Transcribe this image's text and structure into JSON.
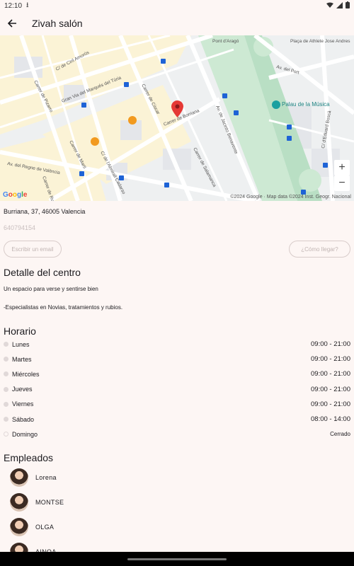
{
  "status_bar": {
    "time": "12:10"
  },
  "header": {
    "title": "Zivah salón"
  },
  "map": {
    "street_labels": [
      "Gran Via del Marqués del Túria",
      "Carrer de Borriana",
      "Av. de Jacinto Benavente",
      "C/ de l'Almirall Cadarso",
      "Carrer de Ciscar",
      "Carrer de Salamanca",
      "Av. del Regne de València",
      "Carrer de Russafa",
      "C/ de Ciril Amorós",
      "Carrer de Pizarro",
      "Carrer de Marti",
      "Av. del Port",
      "Palau de la Música",
      "Pont d'Aragó",
      "Plaça de Athlete Jose Andres",
      "C/ d'Eduard Boscà"
    ],
    "google_logo": "Google",
    "copyright": "©2024 Google · Map data ©2024 Inst. Geogr. Nacional"
  },
  "contact": {
    "address": "Burriana, 37, 46005 Valencia",
    "phone": "640794154",
    "email_button": "Escribir un email",
    "route_button": "¿Cómo llegar?"
  },
  "detail": {
    "title": "Detalle del centro",
    "line1": "Un espacio para verse y sentirse bien",
    "line2": "-Especialistas en Novias, tratamientos y rubios."
  },
  "schedule": {
    "title": "Horario",
    "days": [
      {
        "day": "Lunes",
        "hours": "09:00 - 21:00"
      },
      {
        "day": "Martes",
        "hours": "09:00 - 21:00"
      },
      {
        "day": "Miércoles",
        "hours": "09:00 - 21:00"
      },
      {
        "day": "Jueves",
        "hours": "09:00 - 21:00"
      },
      {
        "day": "Viernes",
        "hours": "09:00 - 21:00"
      },
      {
        "day": "Sábado",
        "hours": "08:00 - 14:00"
      },
      {
        "day": "Domingo",
        "hours": "Cerrado"
      }
    ]
  },
  "employees": {
    "title": "Empleados",
    "list": [
      {
        "name": "Lorena"
      },
      {
        "name": "MONTSE"
      },
      {
        "name": "OLGA"
      },
      {
        "name": "AINOA"
      }
    ]
  },
  "colors": {
    "background": "#fdf6f4",
    "pin": "#e53935",
    "park": "#cde9d3"
  }
}
